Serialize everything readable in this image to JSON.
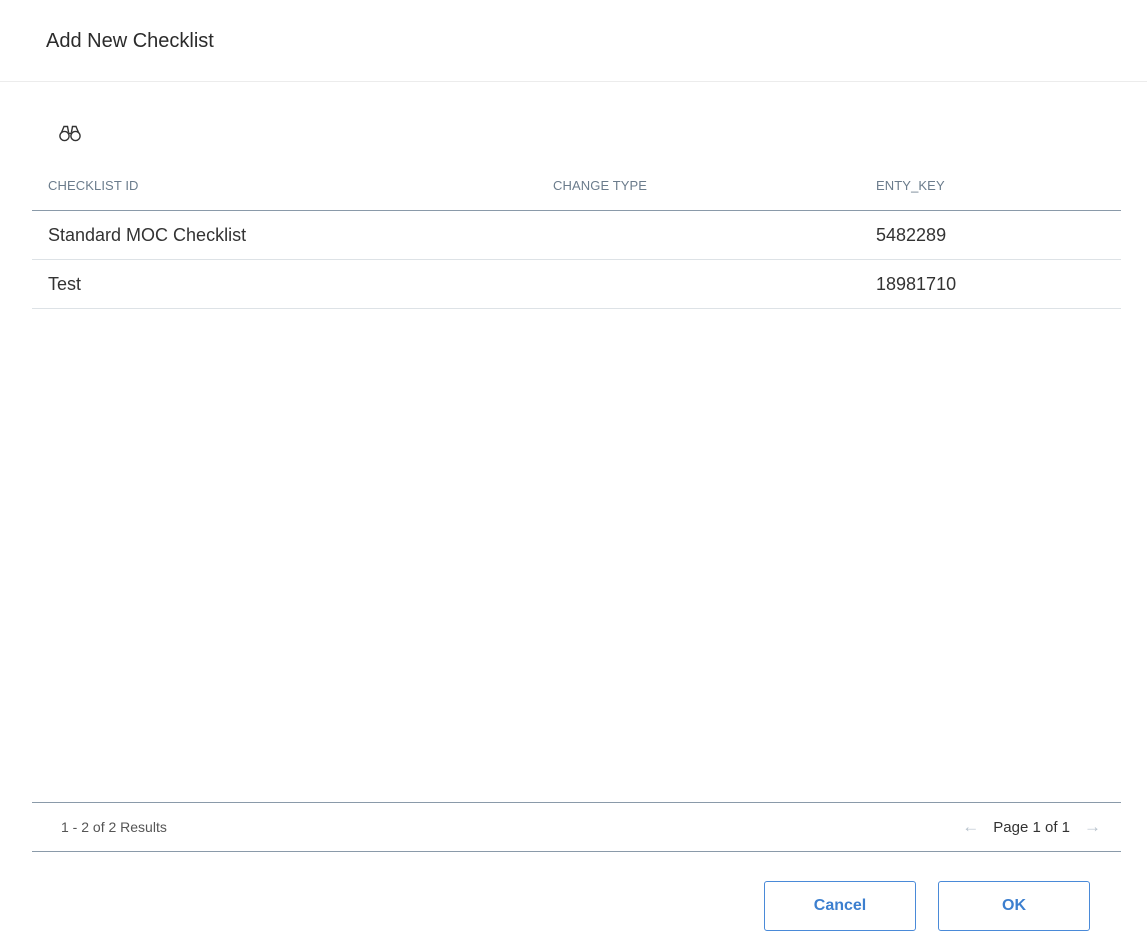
{
  "dialog": {
    "title": "Add New Checklist"
  },
  "toolbar": {
    "search_icon": "binoculars-icon"
  },
  "grid": {
    "columns": [
      "CHECKLIST ID",
      "CHANGE TYPE",
      "ENTY_KEY"
    ],
    "rows": [
      [
        "Standard MOC Checklist",
        "",
        "5482289"
      ],
      [
        "Test",
        "",
        "18981710"
      ]
    ]
  },
  "footer": {
    "result_count": "1 - 2 of 2 Results",
    "page_label": "Page 1 of 1",
    "prev_icon": "arrow-left-icon",
    "next_icon": "arrow-right-icon"
  },
  "buttons": {
    "cancel_label": "Cancel",
    "ok_label": "OK"
  },
  "colors": {
    "accent": "#3c7fcf",
    "header_text": "#6b7c8c",
    "rule": "#8a9aa9"
  }
}
